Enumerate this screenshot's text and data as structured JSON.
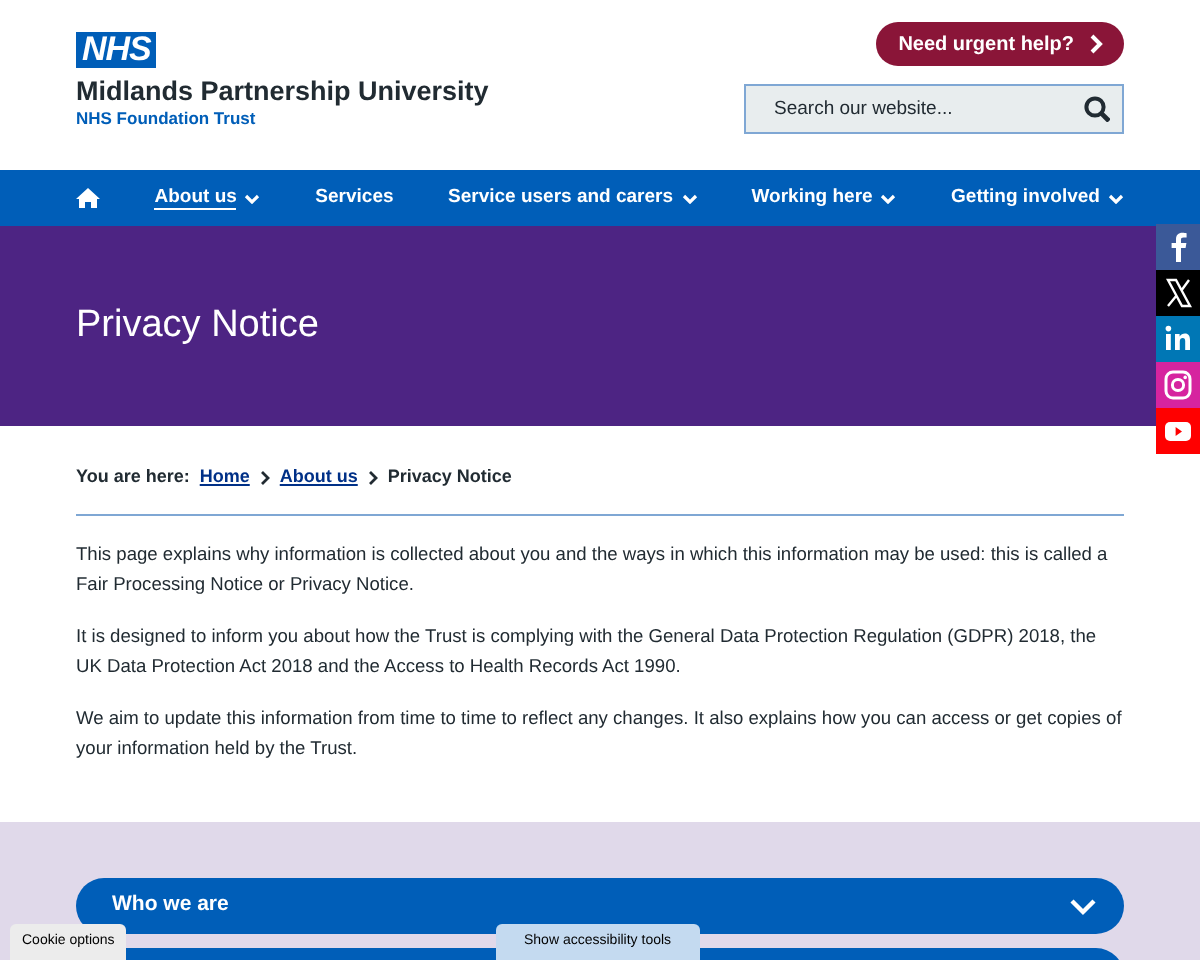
{
  "logo": {
    "badge": "NHS",
    "name": "Midlands Partnership University",
    "subtitle": "NHS Foundation Trust"
  },
  "urgent_button": "Need urgent help?",
  "search": {
    "placeholder": "Search our website..."
  },
  "nav": [
    {
      "label": "About us",
      "selected": true,
      "dropdown": true
    },
    {
      "label": "Services",
      "selected": false,
      "dropdown": false
    },
    {
      "label": "Service users and carers",
      "selected": false,
      "dropdown": true
    },
    {
      "label": "Working here",
      "selected": false,
      "dropdown": true
    },
    {
      "label": "Getting involved",
      "selected": false,
      "dropdown": true
    }
  ],
  "hero": {
    "title": "Privacy Notice"
  },
  "social": [
    {
      "kind": "facebook",
      "color": "#3b5998"
    },
    {
      "kind": "x",
      "color": "#000000"
    },
    {
      "kind": "linkedin",
      "color": "#0077b5"
    },
    {
      "kind": "instagram",
      "color": "#d6249f"
    },
    {
      "kind": "youtube",
      "color": "#ff0000"
    }
  ],
  "breadcrumb": {
    "label": "You are here:",
    "links": [
      "Home",
      "About us"
    ],
    "current": "Privacy Notice"
  },
  "paragraphs": [
    "This page explains why information is collected about you and the ways in which this information may be used: this is called a Fair Processing Notice or Privacy Notice.",
    "It is designed to inform you about how the Trust is complying with the General Data Protection Regulation (GDPR) 2018, the UK Data Protection Act 2018 and the Access to Health Records Act 1990.",
    "We aim to update this information from time to time to reflect any changes. It also explains how you can access or get copies of your information held by the Trust."
  ],
  "accordion": [
    {
      "label": "Who we are",
      "expanded": false
    }
  ],
  "cookie_button": "Cookie options",
  "accessibility_button": "Show accessibility tools"
}
